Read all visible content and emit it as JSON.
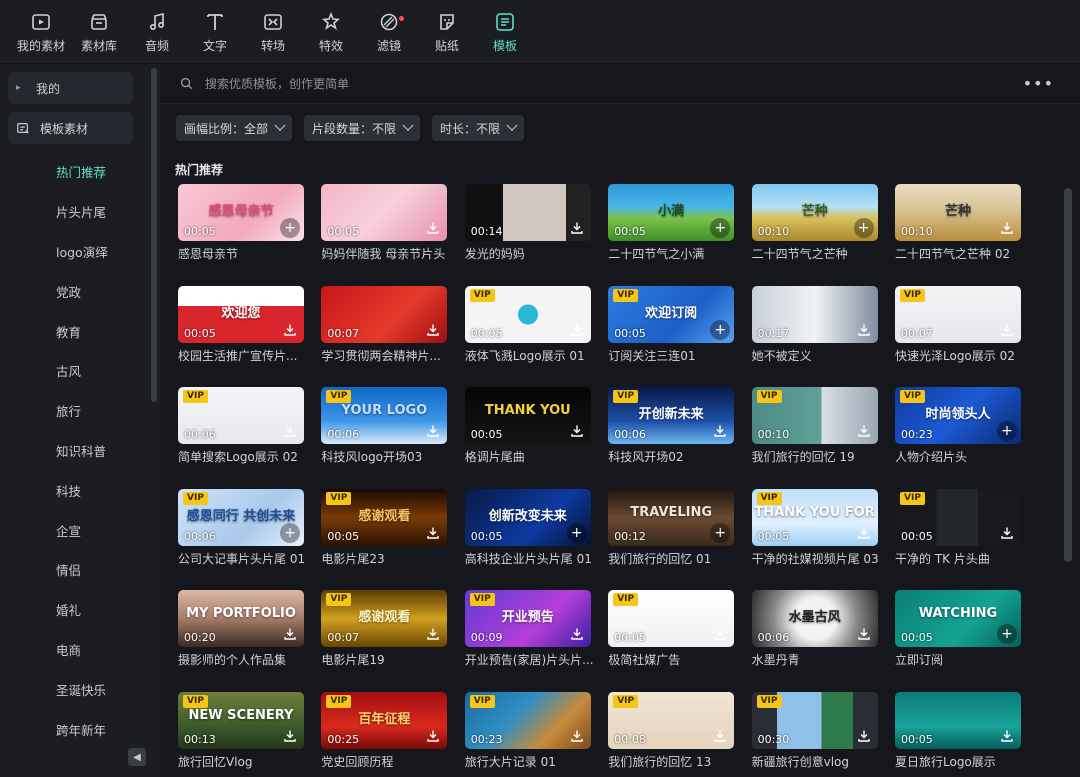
{
  "toolbar": [
    {
      "label": "我的素材",
      "icon": "my-assets-icon",
      "active": false,
      "dot": false
    },
    {
      "label": "素材库",
      "icon": "library-icon",
      "active": false,
      "dot": false
    },
    {
      "label": "音频",
      "icon": "music-note-icon",
      "active": false,
      "dot": false
    },
    {
      "label": "文字",
      "icon": "text-icon",
      "active": false,
      "dot": false
    },
    {
      "label": "转场",
      "icon": "transition-icon",
      "active": false,
      "dot": false
    },
    {
      "label": "特效",
      "icon": "effects-icon",
      "active": false,
      "dot": false
    },
    {
      "label": "滤镜",
      "icon": "filter-icon",
      "active": false,
      "dot": true
    },
    {
      "label": "贴纸",
      "icon": "sticker-icon",
      "active": false,
      "dot": false
    },
    {
      "label": "模板",
      "icon": "template-icon",
      "active": true,
      "dot": false
    }
  ],
  "sidebar": {
    "mine": "我的",
    "category": "模板素材",
    "items": [
      "热门推荐",
      "片头片尾",
      "logo演绎",
      "党政",
      "教育",
      "古风",
      "旅行",
      "知识科普",
      "科技",
      "企宣",
      "情侣",
      "婚礼",
      "电商",
      "圣诞快乐",
      "跨年新年"
    ],
    "active_index": 0
  },
  "search": {
    "placeholder": "搜索优质模板，创作更简单"
  },
  "filters": [
    "画幅比例：全部",
    "片段数量：不限",
    "时长：不限"
  ],
  "section_title": "热门推荐",
  "accent": "#5fe0c4",
  "cards": [
    {
      "name": "感恩母亲节",
      "dur": "00:05",
      "vip": false,
      "act": "add",
      "overlay": "感恩母亲节",
      "bg": "linear-gradient(135deg,#f7c9d6,#f3a8bd 60%,#fbe3ea)",
      "tc": "#e04a78"
    },
    {
      "name": "妈妈伴随我 母亲节片头",
      "dur": "00:05",
      "vip": false,
      "act": "dl",
      "overlay": "",
      "bg": "linear-gradient(135deg,#f5b5c8,#f7d0dc 50%,#e88fac)",
      "tc": "#fff"
    },
    {
      "name": "发光的妈妈",
      "dur": "00:14",
      "vip": false,
      "act": "dl",
      "overlay": "",
      "bg": "linear-gradient(90deg,#111 0 30%,#cfc8c0 30% 80%,#222 80%)",
      "tc": "#fff"
    },
    {
      "name": "二十四节气之小满",
      "dur": "00:05",
      "vip": false,
      "act": "add",
      "overlay": "小满",
      "bg": "linear-gradient(180deg,#2e9ad6,#49b6e8 40%,#7cc24b 60%,#3f8f2a)",
      "tc": "#1d4d1a"
    },
    {
      "name": "二十四节气之芒种",
      "dur": "00:10",
      "vip": false,
      "act": "add",
      "overlay": "芒种",
      "bg": "linear-gradient(180deg,#7ec7f0,#b6e0f4 40%,#d8c15c 60%,#a88a2c)",
      "tc": "#3b5d1c"
    },
    {
      "name": "二十四节气之芒种 02",
      "dur": "00:10",
      "vip": false,
      "act": "dl",
      "overlay": "芒种",
      "bg": "linear-gradient(180deg,#e9dcc0,#d9c393 45%,#b88f3e)",
      "tc": "#333"
    },
    {
      "name": "校园生活推广宣传片...",
      "dur": "00:05",
      "vip": false,
      "act": "dl",
      "overlay": "欢迎您",
      "bg": "linear-gradient(180deg,#ffffff 0 35%,#d8262c 35%)",
      "tc": "#fff"
    },
    {
      "name": "学习贯彻两会精神片...",
      "dur": "00:07",
      "vip": false,
      "act": "dl",
      "overlay": "",
      "bg": "linear-gradient(135deg,#c9151b,#e43a2a 60%,#9c0d0f)",
      "tc": "#ffd76a"
    },
    {
      "name": "液体飞溅Logo展示 01",
      "dur": "00:05",
      "vip": true,
      "act": "dl",
      "overlay": "",
      "bg": "radial-gradient(circle at 50% 50%,#2bb6d6 0 14%,#f2f4f6 15%)",
      "tc": "#fff"
    },
    {
      "name": "订阅关注三连01",
      "dur": "00:05",
      "vip": true,
      "act": "add",
      "overlay": "欢迎订阅",
      "bg": "linear-gradient(135deg,#2a7de1,#1d5fc7 60%,#5aa1f2)",
      "tc": "#fff"
    },
    {
      "name": "她不被定义",
      "dur": "00:17",
      "vip": false,
      "act": "dl",
      "overlay": "",
      "bg": "linear-gradient(90deg,#c8cfd9,#f0f2f5 50%,#7f8da0)",
      "tc": "#fff"
    },
    {
      "name": "快速光泽Logo展示 02",
      "dur": "00:07",
      "vip": true,
      "act": "dl",
      "overlay": "",
      "bg": "linear-gradient(180deg,#f2f3f5,#e5e7ea)",
      "tc": "#fff"
    },
    {
      "name": "简单搜索Logo展示 02",
      "dur": "00:06",
      "vip": true,
      "act": "dl",
      "overlay": "",
      "bg": "linear-gradient(180deg,#f4f5f7,#e6e8eb)",
      "tc": "#fff"
    },
    {
      "name": "科技风logo开场03",
      "dur": "00:06",
      "vip": true,
      "act": "dl",
      "overlay": "YOUR LOGO",
      "bg": "linear-gradient(180deg,#0f66c8,#3f97e8 60%,#d9ecfb)",
      "tc": "#bfe1ff"
    },
    {
      "name": "格调片尾曲",
      "dur": "00:05",
      "vip": false,
      "act": "dl",
      "overlay": "THANK YOU",
      "bg": "linear-gradient(180deg,#050505,#141414)",
      "tc": "#f2d13a"
    },
    {
      "name": "科技风开场02",
      "dur": "00:06",
      "vip": true,
      "act": "dl",
      "overlay": "开创新未来",
      "bg": "linear-gradient(180deg,#081a4a,#1d4fa8 60%,#6fb7f0)",
      "tc": "#fff"
    },
    {
      "name": "我们旅行的回忆 19",
      "dur": "00:10",
      "vip": true,
      "act": "dl",
      "overlay": "",
      "bg": "linear-gradient(90deg,#4d8a83,#5fa098 55%,#d9dfe4 55%,#9aa6b3)",
      "tc": "#fff"
    },
    {
      "name": "人物介绍片头",
      "dur": "00:23",
      "vip": true,
      "act": "add",
      "overlay": "时尚领头人",
      "bg": "linear-gradient(135deg,#0e3a9c,#1d5ad6 50%,#0a2a70)",
      "tc": "#fff"
    },
    {
      "name": "公司大记事片头片尾 01",
      "dur": "00:06",
      "vip": true,
      "act": "add",
      "overlay": "感恩同行 共创未来",
      "bg": "linear-gradient(135deg,#cfe3f7,#a9c9ec 60%,#e8f1fb)",
      "tc": "#1d4f9c"
    },
    {
      "name": "电影片尾23",
      "dur": "00:05",
      "vip": true,
      "act": "dl",
      "overlay": "感谢观看",
      "bg": "linear-gradient(180deg,#1a0a00,#7a3a08 50%,#2a1200)",
      "tc": "#f5c163"
    },
    {
      "name": "高科技企业片头片尾 01",
      "dur": "00:05",
      "vip": false,
      "act": "add",
      "overlay": "创新改变未来",
      "bg": "linear-gradient(135deg,#061a48,#0e3aa0 60%,#051233)",
      "tc": "#fff"
    },
    {
      "name": "我们旅行的回忆 01",
      "dur": "00:12",
      "vip": false,
      "act": "add",
      "overlay": "TRAVELING",
      "bg": "linear-gradient(180deg,#20150e,#6a4a33 50%,#3a2a1c)",
      "tc": "#f0e6d8"
    },
    {
      "name": "干净的社媒视频片尾 03",
      "dur": "00:05",
      "vip": true,
      "act": "dl",
      "overlay": "THANK YOU FOR",
      "bg": "linear-gradient(180deg,#bfe0fb,#e1f0fd 60%,#9fcff6)",
      "tc": "#fff"
    },
    {
      "name": "干净的 TK 片头曲",
      "dur": "00:05",
      "vip": true,
      "act": "dl",
      "overlay": "",
      "bg": "linear-gradient(90deg,#17191d 0 33%,#23262b 33% 66%,#17191d 66%)",
      "tc": "#fff"
    },
    {
      "name": "摄影师的个人作品集",
      "dur": "00:20",
      "vip": false,
      "act": "dl",
      "overlay": "MY PORTFOLIO",
      "bg": "linear-gradient(180deg,#d9b9a6,#a67c68 50%,#3a2a22)",
      "tc": "#fff"
    },
    {
      "name": "电影片尾19",
      "dur": "00:07",
      "vip": true,
      "act": "dl",
      "overlay": "感谢观看",
      "bg": "linear-gradient(180deg,#5a3a02,#d2a020 50%,#6a4604)",
      "tc": "#fff3c0"
    },
    {
      "name": "开业预告(家居)片头片...",
      "dur": "00:09",
      "vip": true,
      "act": "dl",
      "overlay": "开业预告",
      "bg": "linear-gradient(135deg,#5f3bd6,#b43ed8 60%,#3a1fa0)",
      "tc": "#fff"
    },
    {
      "name": "极简社媒广告",
      "dur": "00:05",
      "vip": true,
      "act": "dl",
      "overlay": "",
      "bg": "linear-gradient(180deg,#ffffff,#eef0f2)",
      "tc": "#333"
    },
    {
      "name": "水墨丹青",
      "dur": "00:06",
      "vip": false,
      "act": "dl",
      "overlay": "水墨古风",
      "bg": "radial-gradient(circle at 50% 50%,#f2f2f2 0 30%,#8a8a8a 60%,#2a2a2a)",
      "tc": "#222"
    },
    {
      "name": "立即订阅",
      "dur": "00:05",
      "vip": false,
      "act": "add",
      "overlay": "WATCHING",
      "bg": "linear-gradient(135deg,#0a7f76,#13a393 60%,#066058)",
      "tc": "#fff"
    },
    {
      "name": "旅行回忆Vlog",
      "dur": "00:13",
      "vip": true,
      "act": "dl",
      "overlay": "NEW SCENERY",
      "bg": "linear-gradient(180deg,#6f7f3c,#3c5a2a 60%,#25361a)",
      "tc": "#fff"
    },
    {
      "name": "党史回顾历程",
      "dur": "00:25",
      "vip": true,
      "act": "dl",
      "overlay": "百年征程",
      "bg": "linear-gradient(180deg,#a40d10,#d92a1e 60%,#7a0808)",
      "tc": "#ffd76a"
    },
    {
      "name": "旅行大片记录 01",
      "dur": "00:23",
      "vip": true,
      "act": "dl",
      "overlay": "",
      "bg": "linear-gradient(135deg,#1b6a9c,#2f8fc3 40%,#c88a3a 70%,#7a4a1c)",
      "tc": "#fff"
    },
    {
      "name": "我们旅行的回忆 13",
      "dur": "00:08",
      "vip": true,
      "act": "dl",
      "overlay": "",
      "bg": "linear-gradient(180deg,#f1e6d4,#e3d3ba)",
      "tc": "#333"
    },
    {
      "name": "新疆旅行创意vlog",
      "dur": "00:30",
      "vip": true,
      "act": "dl",
      "overlay": "",
      "bg": "linear-gradient(90deg,#2a2d33 0 20%,#8fc0e8 20% 55%,#2f7a4a 55% 80%,#2a2d33 80%)",
      "tc": "#fff"
    },
    {
      "name": "夏日旅行Logo展示",
      "dur": "00:05",
      "vip": false,
      "act": "dl",
      "overlay": "",
      "bg": "linear-gradient(180deg,#0b7c79,#18a39a 60%,#075e5b)",
      "tc": "#fff"
    }
  ]
}
